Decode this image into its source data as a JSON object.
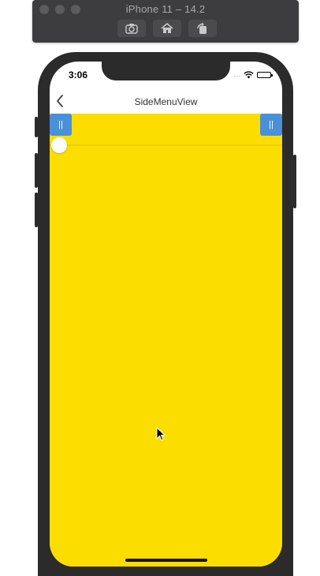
{
  "simulator": {
    "title": "iPhone 11 – 14.2",
    "toolbar_buttons": [
      {
        "icon": "screenshot-icon"
      },
      {
        "icon": "home-icon"
      },
      {
        "icon": "rotate-icon"
      }
    ]
  },
  "status_bar": {
    "time": "3:06",
    "signal": "....",
    "wifi_icon": "wifi-icon",
    "battery_icon": "battery-icon"
  },
  "navbar": {
    "back_icon": "chevron-left-icon",
    "title": "SideMenuView"
  },
  "content": {
    "background_color": "#fcdd00",
    "left_handle_label": "||",
    "right_handle_label": "||",
    "handle_color": "#4a90d9"
  }
}
